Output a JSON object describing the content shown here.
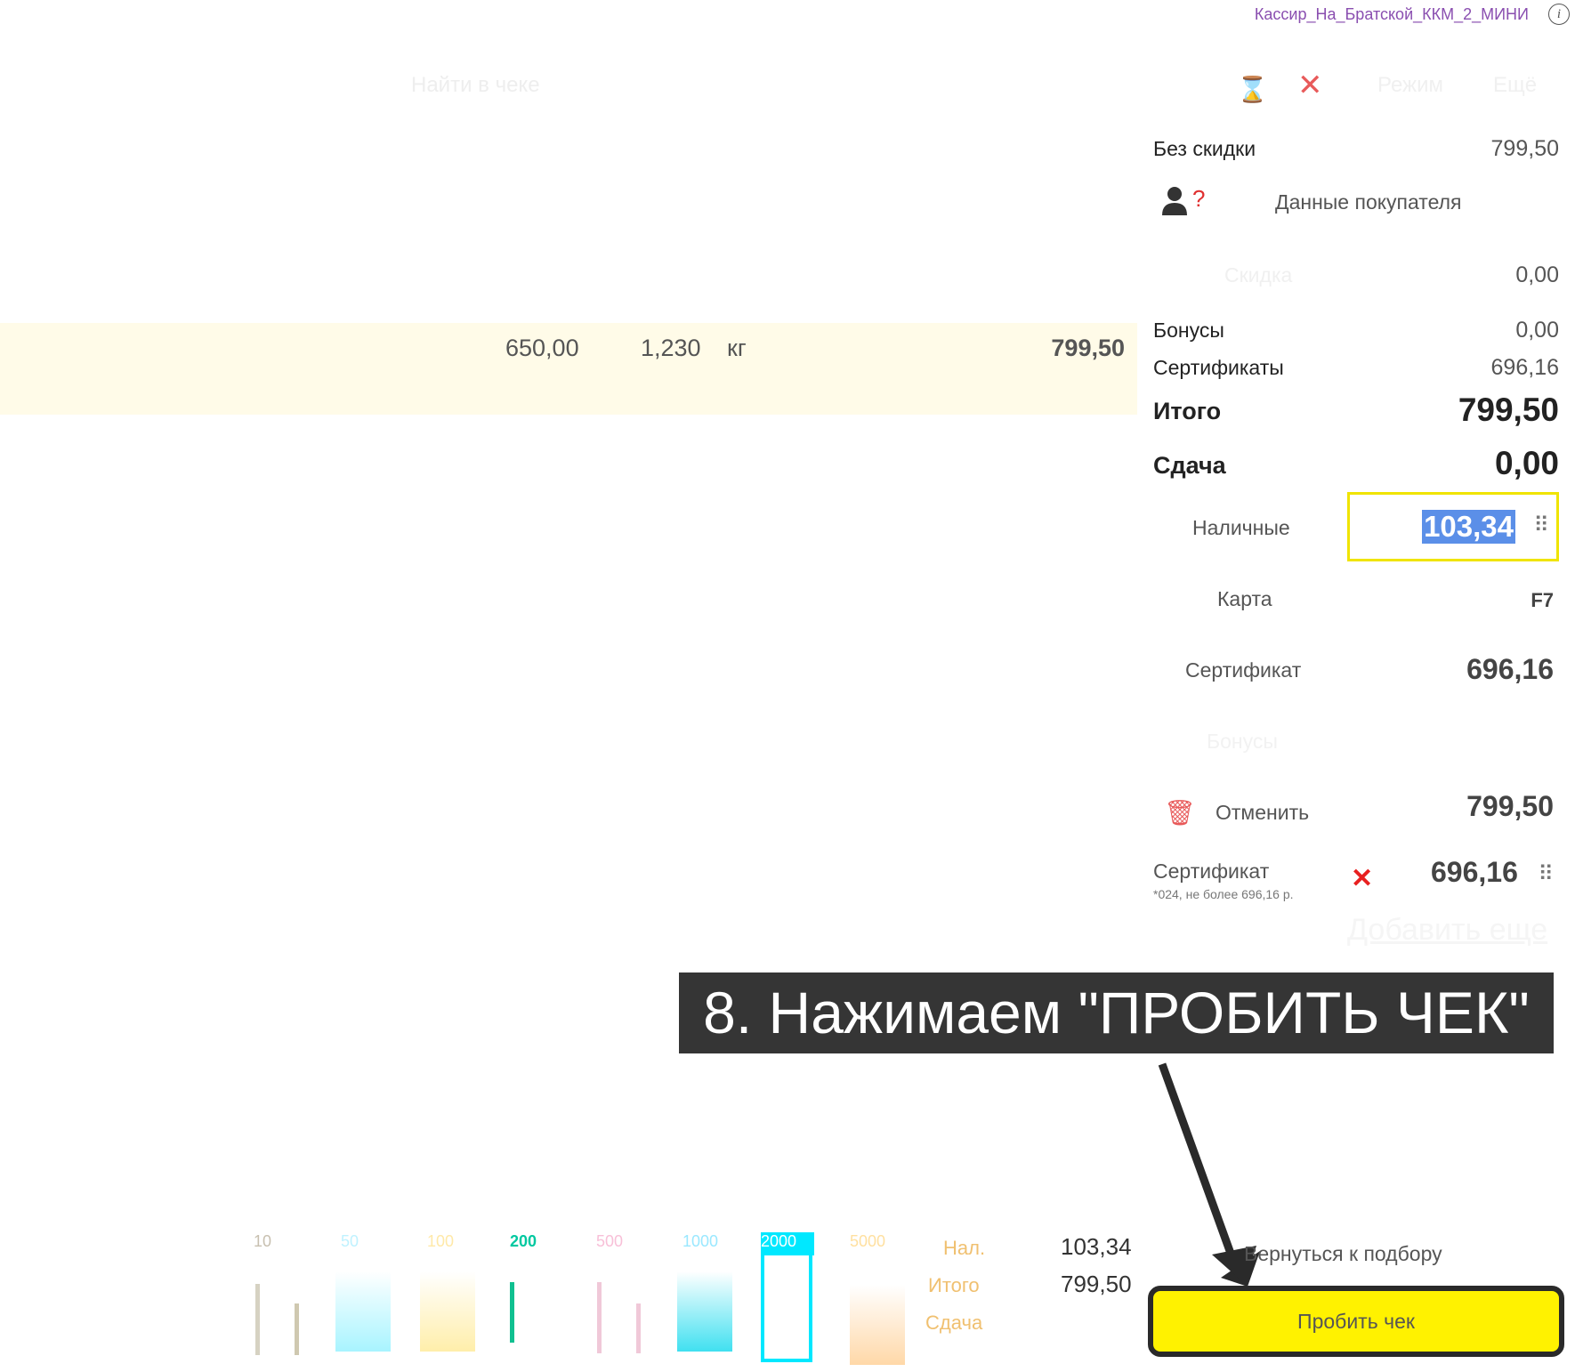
{
  "header": {
    "cashier": "Кассир_На_Братской_ККМ_2_МИНИ",
    "search_placeholder": "Найти в чеке",
    "mode_label": "Режим",
    "more_label": "Ещё"
  },
  "item": {
    "price": "650,00",
    "quantity": "1,230",
    "unit": "кг",
    "sum": "799,50"
  },
  "summary": {
    "no_discount_label": "Без скидки",
    "no_discount_value": "799,50",
    "customer_label": "Данные покупателя",
    "discount_label": "Скидка",
    "discount_value": "0,00",
    "bonuses_label": "Бонусы",
    "bonuses_value": "0,00",
    "certificates_label": "Сертификаты",
    "certificates_value": "696,16",
    "total_label": "Итого",
    "total_value": "799,50",
    "change_label": "Сдача",
    "change_value": "0,00"
  },
  "payment": {
    "cash_label": "Наличные",
    "cash_value": "103,34",
    "card_label": "Карта",
    "card_key": "F7",
    "certificate_label": "Сертификат",
    "certificate_value": "696,16",
    "bonuses_label": "Бонусы",
    "cancel_label": "Отменить",
    "cancel_value": "799,50",
    "applied_cert_label": "Сертификат",
    "applied_cert_note": "*024, не более 696,16 р.",
    "applied_cert_value": "696,16",
    "add_more": "Добавить еще"
  },
  "annotation": {
    "banner": "8. Нажимаем \"ПРОБИТЬ ЧЕК\""
  },
  "footer": {
    "denominations": [
      "10",
      "50",
      "100",
      "200",
      "500",
      "1000",
      "2000",
      "5000"
    ],
    "cash_short_label": "Нал.",
    "cash_short_value": "103,34",
    "total_label": "Итого",
    "total_value": "799,50",
    "change_label": "Сдача",
    "back_label": "Вернуться к подбору",
    "pay_button": "Пробить чек"
  },
  "colors": {
    "accent_yellow": "#fff200",
    "highlight": "#5b8fe8",
    "cashier_purple": "#8a4fb0",
    "danger_red": "#e82020"
  }
}
